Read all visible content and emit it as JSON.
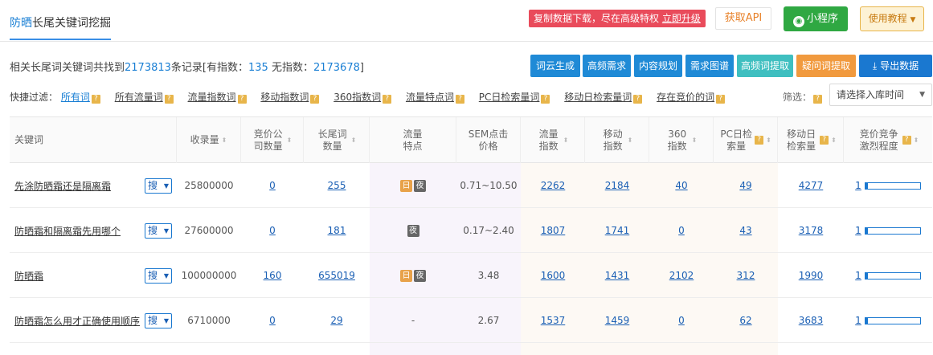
{
  "header": {
    "title_accent": "防晒",
    "title_rest": "长尾关键词挖掘",
    "promo_text": "复制数据下载，尽在高级特权",
    "promo_link": "立即升级",
    "api_label": "获取API",
    "mini_program_label": "小程序",
    "tutorial_label": "使用教程"
  },
  "stats": {
    "prefix": "相关长尾词关键词共找到",
    "total": "2173813",
    "mid": "条记录[有指数：",
    "with_index": "135",
    "mid2": " 无指数：",
    "without_index": "2173678",
    "suffix": "]"
  },
  "actions": {
    "word_cloud": "词云生成",
    "high_freq": "高频需求",
    "content_plan": "内容规划",
    "demand_map": "需求图谱",
    "high_freq_extract": "高频词提取",
    "question_extract": "疑问词提取",
    "export": "导出数据"
  },
  "filters": {
    "label": "快捷过滤：",
    "items": [
      "所有词",
      "所有流量词",
      "流量指数词",
      "移动指数词",
      "360指数词",
      "流量特点词",
      "PC日检索量词",
      "移动日检索量词",
      "存在竞价的词"
    ],
    "screen_label": "筛选：",
    "select_value": "请选择入库时间"
  },
  "table": {
    "headers": {
      "keyword": "关键词",
      "indexed": "收录量",
      "bid_companies": "竞价公司数量",
      "longtail": "长尾词数量",
      "traffic_feature": "流量特点",
      "sem": "SEM点击价格",
      "traffic_index": "流量指数",
      "mobile_index": "移动指数",
      "idx360": "360指数",
      "pc_daily": "PC日检索量",
      "mobile_daily": "移动日检索量",
      "competition": "竞价竞争激烈程度"
    },
    "search_label": "搜",
    "day_label": "日",
    "night_label": "夜",
    "rows": [
      {
        "keyword": "先涂防晒霜还是隔离霜",
        "indexed": "25800000",
        "bid": "0",
        "longtail": "255",
        "feature": [
          "day",
          "night"
        ],
        "sem": "0.71~10.50",
        "traffic": "2262",
        "mobile": "2184",
        "idx360": "40",
        "pc": "49",
        "mdaily": "4277",
        "comp": "1",
        "comp_level": 0.04
      },
      {
        "keyword": "防晒霜和隔离霜先用哪个",
        "indexed": "27600000",
        "bid": "0",
        "longtail": "181",
        "feature": [
          "night"
        ],
        "sem": "0.17~2.40",
        "traffic": "1807",
        "mobile": "1741",
        "idx360": "0",
        "pc": "43",
        "mdaily": "3178",
        "comp": "1",
        "comp_level": 0.04
      },
      {
        "keyword": "防晒霜",
        "indexed": "100000000",
        "bid": "160",
        "longtail": "655019",
        "feature": [
          "day",
          "night"
        ],
        "sem": "3.48",
        "traffic": "1600",
        "mobile": "1431",
        "idx360": "2102",
        "pc": "312",
        "mdaily": "1990",
        "comp": "1",
        "comp_level": 0.04
      },
      {
        "keyword": "防晒霜怎么用才正确使用顺序",
        "indexed": "6710000",
        "bid": "0",
        "longtail": "29",
        "feature": [],
        "sem": "2.67",
        "traffic": "1537",
        "mobile": "1459",
        "idx360": "0",
        "pc": "62",
        "mdaily": "3683",
        "comp": "1",
        "comp_level": 0.04,
        "feature_empty": "-"
      }
    ]
  }
}
